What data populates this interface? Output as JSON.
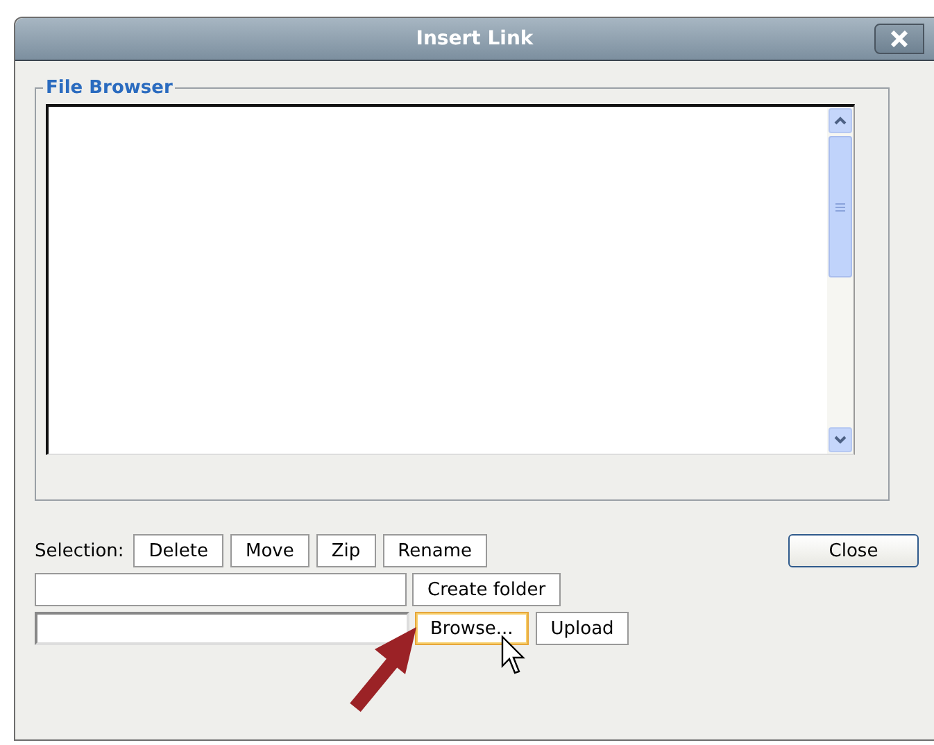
{
  "window": {
    "title": "Insert Link"
  },
  "file_browser": {
    "legend": "File Browser"
  },
  "selection": {
    "label": "Selection:",
    "buttons": [
      {
        "label": "Delete"
      },
      {
        "label": "Move"
      },
      {
        "label": "Zip"
      },
      {
        "label": "Rename"
      }
    ]
  },
  "close_button": {
    "label": "Close"
  },
  "folder_row": {
    "button": {
      "label": "Create folder",
      "hovered": false
    }
  },
  "upload_row": {
    "buttons": [
      {
        "label": "Browse...",
        "hovered": true
      },
      {
        "label": "Upload",
        "hovered": false
      }
    ]
  }
}
